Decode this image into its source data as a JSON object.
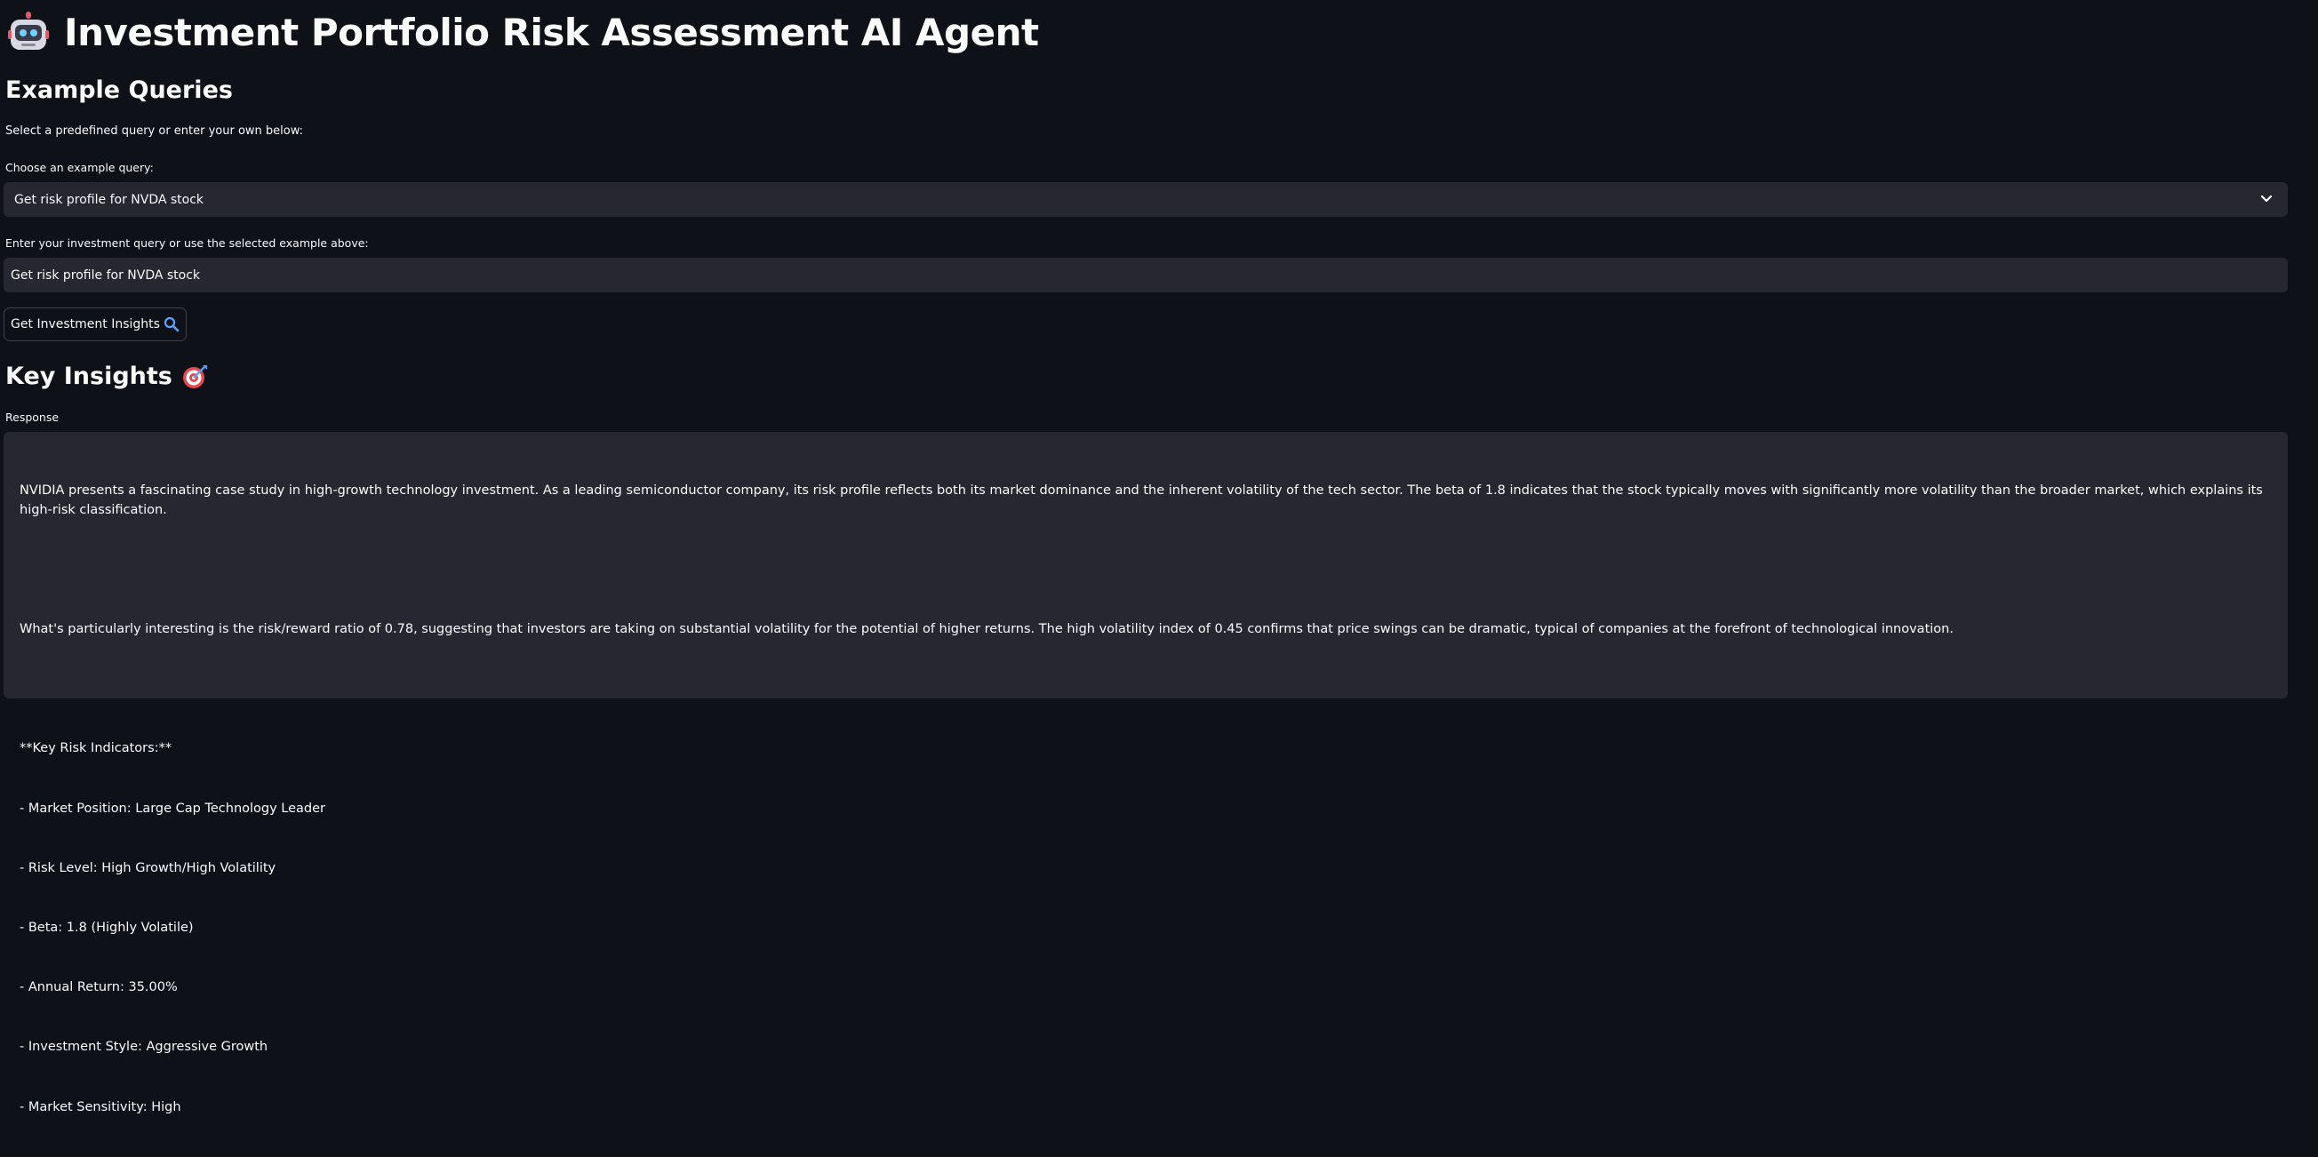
{
  "header": {
    "title": "Investment Portfolio Risk Assessment AI Agent",
    "icon": "robot-icon"
  },
  "examples": {
    "heading": "Example Queries",
    "intro": "Select a predefined query or enter your own below:",
    "select_label": "Choose an example query:",
    "select_value": "Get risk profile for NVDA stock"
  },
  "query": {
    "label": "Enter your investment query or use the selected example above:",
    "value": "Get risk profile for NVDA stock"
  },
  "button": {
    "label": "Get Investment Insights",
    "icon": "magnifier-icon"
  },
  "insights": {
    "heading": "Key Insights",
    "icon": "target-icon",
    "response_label": "Response",
    "paragraph1": "NVIDIA presents a fascinating case study in high-growth technology investment. As a leading semiconductor company, its risk profile reflects both its market dominance and the inherent volatility of the tech sector. The beta of 1.8 indicates that the stock typically moves with significantly more volatility than the broader market, which explains its high-risk classification.",
    "paragraph2": "What's particularly interesting is the risk/reward ratio of 0.78, suggesting that investors are taking on substantial volatility for the potential of higher returns. The high volatility index of 0.45 confirms that price swings can be dramatic, typical of companies at the forefront of technological innovation.",
    "indicators_heading": "**Key Risk Indicators:**",
    "indicators": [
      "- Market Position: Large Cap Technology Leader",
      "- Risk Level: High Growth/High Volatility",
      "- Beta: 1.8 (Highly Volatile)",
      "- Annual Return: 35.00%",
      "- Investment Style: Aggressive Growth",
      "- Market Sensitivity: High"
    ]
  },
  "colors": {
    "background": "#0e1117",
    "field": "#262730",
    "text": "#fafafa"
  }
}
